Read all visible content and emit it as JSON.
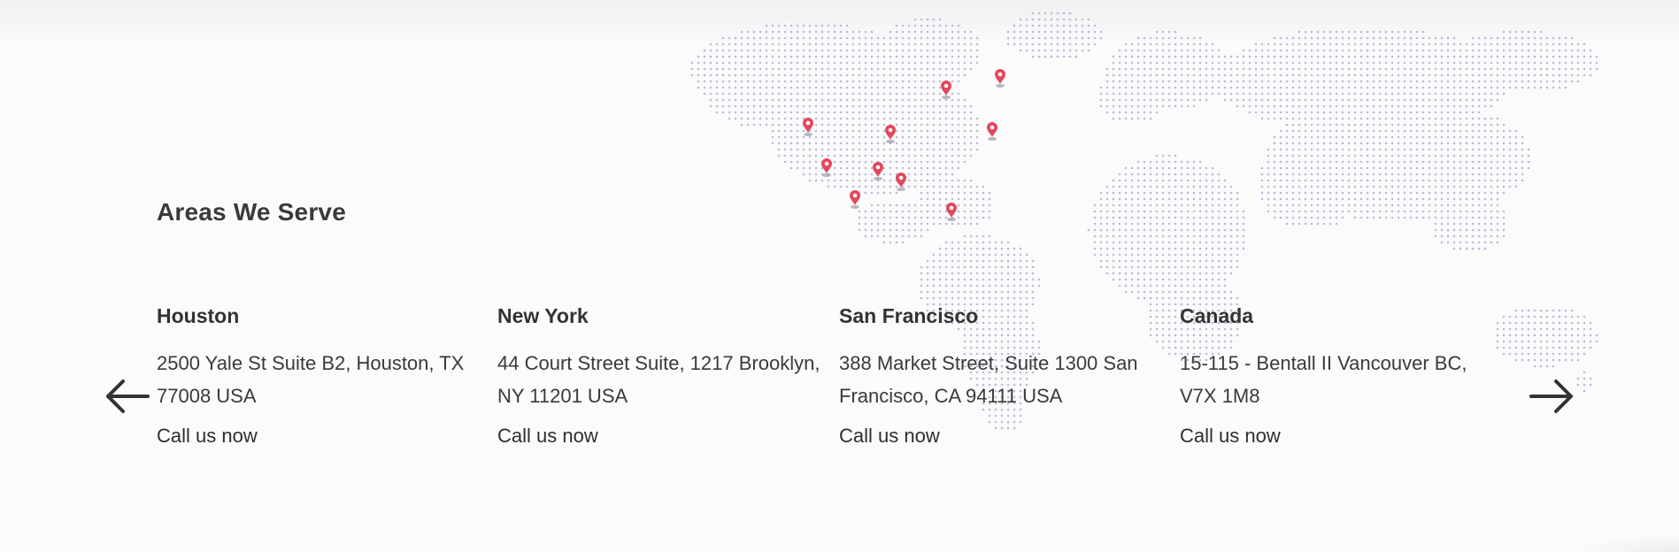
{
  "section": {
    "title": "Areas We Serve"
  },
  "locations": [
    {
      "city": "Houston",
      "address": "2500 Yale St Suite B2, Houston, TX 77008 USA",
      "cta": "Call us now"
    },
    {
      "city": "New York",
      "address": "44 Court Street Suite, 1217 Brooklyn, NY 11201 USA",
      "cta": "Call us now"
    },
    {
      "city": "San Francisco",
      "address": "388 Market Street, Suite 1300 San Francisco, CA 94111 USA",
      "cta": "Call us now"
    },
    {
      "city": "Canada",
      "address": "15-115 - Bentall II Vancouver BC, V7X 1M8",
      "cta": "Call us now"
    }
  ],
  "icons": {
    "prev": "arrow-left-icon",
    "next": "arrow-right-icon",
    "pin": "map-pin-icon"
  },
  "colors": {
    "map_dots": "#b9bcd8",
    "pin": "#e5475c",
    "text": "#333333",
    "background": "#fbfbfc"
  }
}
